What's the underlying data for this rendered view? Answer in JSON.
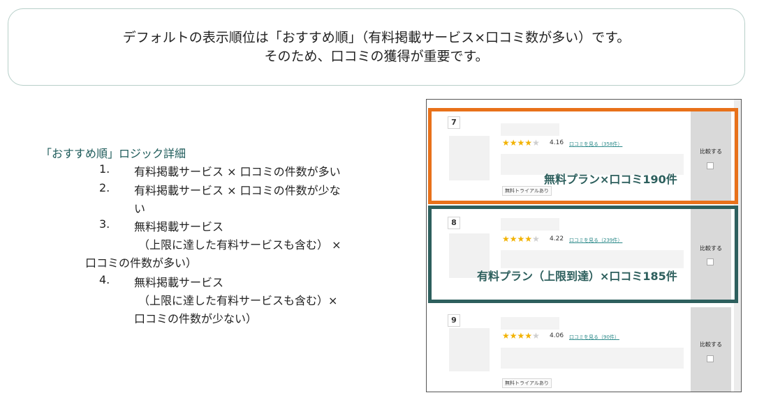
{
  "header": {
    "line1": "デフォルトの表示順位は「おすすめ順」（有料掲載サービス×口コミ数が多い）です。",
    "line2": "そのため、口コミの獲得が重要です。"
  },
  "logic": {
    "title": "「おすすめ順」ロジック詳細",
    "items": [
      {
        "num": "1.",
        "line1": "有料掲載サービス × 口コミの件数が多い"
      },
      {
        "num": "2.",
        "line1": "有料掲載サービス × 口コミの件数が少な",
        "line2": "い"
      },
      {
        "num": "3.",
        "line1": "無料掲載サービス",
        "line2": "（上限に達した有料サービスも含む） ×",
        "line3": "口コミの件数が多い）"
      },
      {
        "num": "4.",
        "line1": "無料掲載サービス",
        "line2": "（上限に達した有料サービスも含む）×",
        "line3": "口コミの件数が少ない）"
      }
    ]
  },
  "listing": {
    "cards": [
      {
        "rank": "7",
        "rating": 4.16,
        "score": "4.16",
        "review_link": "口コミを見る（358件）",
        "badge": "無料トライアルあり",
        "compare": "比較する"
      },
      {
        "rank": "8",
        "rating": 4.22,
        "score": "4.22",
        "review_link": "口コミを見る（239件）",
        "compare": "比較する"
      },
      {
        "rank": "9",
        "rating": 4.06,
        "score": "4.06",
        "review_link": "口コミを見る（90件）",
        "badge": "無料トライアルあり",
        "compare": "比較する"
      }
    ],
    "highlights": {
      "orange_label": "無料プラン×口コミ190件",
      "teal_label": "有料プラン（上限到達）×口コミ185件"
    },
    "colors": {
      "orange": "#e8711a",
      "teal": "#2d5f5d",
      "star": "#f2b200"
    },
    "icons": {
      "star": "star-icon",
      "checkbox": "checkbox-icon"
    }
  }
}
